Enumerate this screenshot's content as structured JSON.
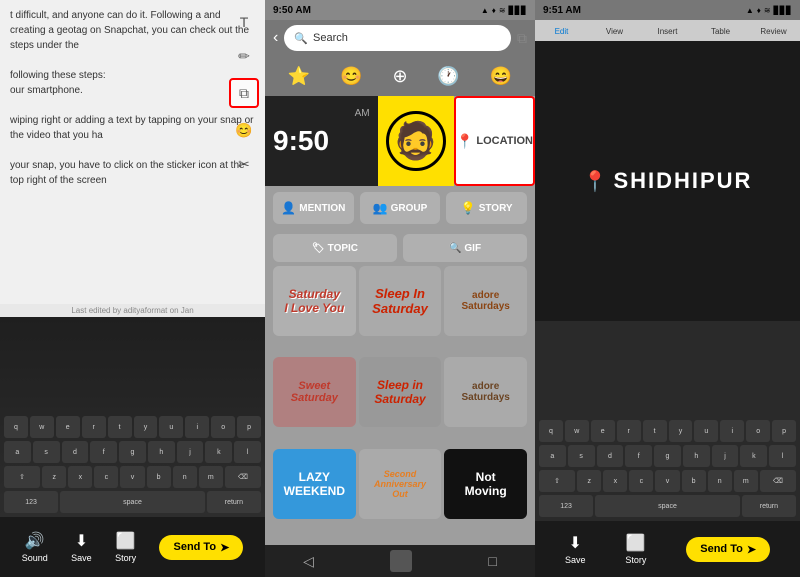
{
  "left_panel": {
    "content_text": "t difficult, and anyone can do it. Following a and creating a geotag on Snapchat, you can check out the steps under the",
    "steps_text": "following these steps:",
    "phone_text": "our smartphone.",
    "click_text": "wiping right or adding a text by tapping on your snap or the video that you ha",
    "sticker_text": "your snap, you have to click on the sticker icon at the top right of the screen",
    "last_edited": "Last edited by adityaformat on Jan",
    "footer": {
      "sound_label": "Sound",
      "save_label": "Save",
      "story_label": "Story",
      "send_label": "Send To"
    }
  },
  "middle_panel": {
    "status_time": "9:50 AM",
    "status_icons": "▲ ♦ ᵴ ᵐ ✦",
    "search_placeholder": "Search",
    "categories": [
      "⭐",
      "😊",
      "⊕",
      "🕐",
      "😄"
    ],
    "featured": {
      "clock_time": "9:50",
      "clock_am": "AM",
      "location_label": "LOCATION"
    },
    "action_buttons": [
      {
        "icon": "👤",
        "label": "MENTION"
      },
      {
        "icon": "👥",
        "label": "GROUP"
      },
      {
        "icon": "💡",
        "label": "STORY"
      }
    ],
    "filter_buttons": [
      {
        "icon": "🏷",
        "label": "TOPIC"
      },
      {
        "icon": "🔍",
        "label": "GIF"
      }
    ],
    "stickers": [
      {
        "text": "Saturday\nI Love You",
        "style": "saturday"
      },
      {
        "text": "Sleep In\nSaturday",
        "style": "sleep-in"
      },
      {
        "text": "adore\nSaturdays",
        "style": "adore"
      },
      {
        "text": "Sweet\nSaturday",
        "style": "sweet"
      },
      {
        "text": "Sleep in\nSaturday",
        "style": "sleep2"
      },
      {
        "text": "adore\nSaturdays",
        "style": "adore2"
      },
      {
        "text": "LAZY\nWEEKEND",
        "style": "lazy"
      },
      {
        "text": "Second\nAnniversary\nOut",
        "style": "second"
      },
      {
        "text": "Not\nMoving",
        "style": "notmoving"
      }
    ],
    "bottom_nav": [
      "◁",
      "●",
      "□"
    ]
  },
  "right_panel": {
    "status_time": "9:51 AM",
    "location_name": "SHIDHIPUR",
    "location_pin_icon": "📍",
    "close_icon": "✕",
    "toolbar_icons": [
      "T",
      "✏",
      "📎",
      "😊",
      "✂"
    ],
    "tabs": [
      "Edit",
      "View",
      "Insert",
      "Table",
      "Review"
    ],
    "footer": {
      "save_label": "Save",
      "story_label": "Story",
      "send_label": "Send To"
    }
  },
  "icons": {
    "sound": "🔊",
    "save": "⬇",
    "story": "⬜",
    "send_arrow": "➤",
    "search": "🔍",
    "location_pin": "📍",
    "close": "✕",
    "back_arrow": "‹",
    "sticker_box": "⧉"
  }
}
